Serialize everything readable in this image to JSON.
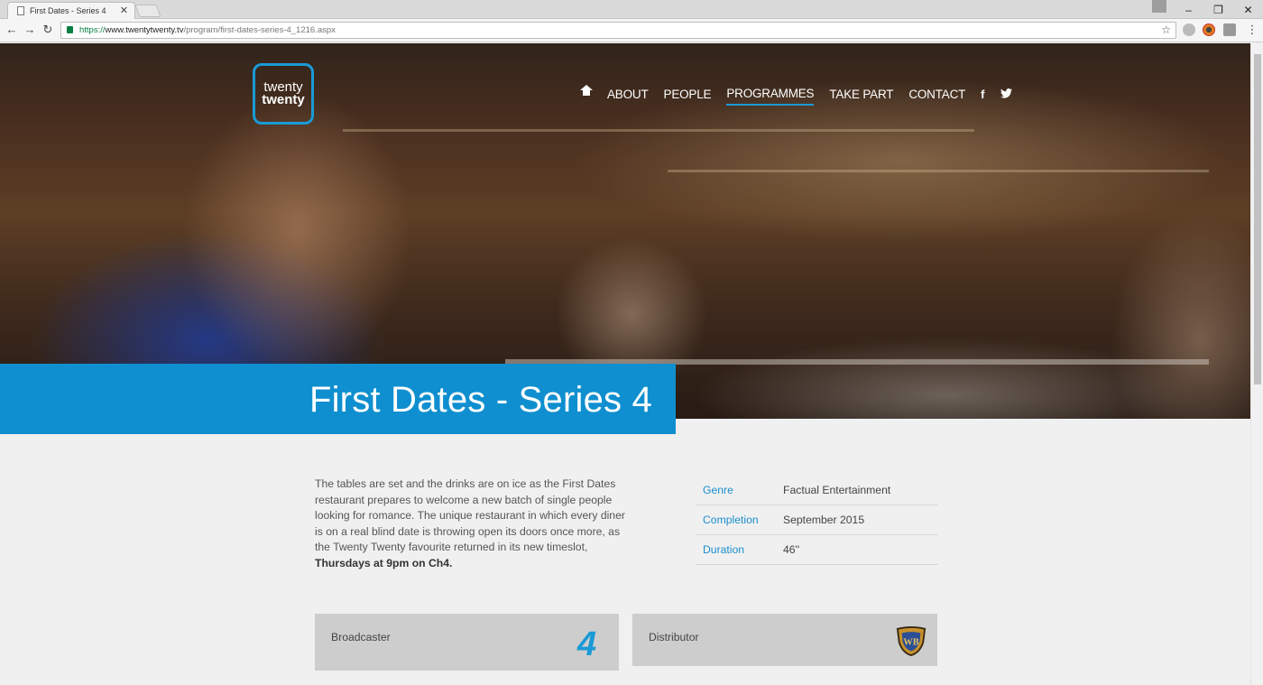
{
  "browser": {
    "tab_title": "First Dates - Series 4",
    "url_scheme": "https://",
    "url_host": "www.twentytwenty.tv",
    "url_path": "/program/first-dates-series-4_1216.aspx"
  },
  "site": {
    "logo_line1": "twenty",
    "logo_line2": "twenty",
    "nav": [
      {
        "label": "ABOUT",
        "active": false
      },
      {
        "label": "PEOPLE",
        "active": false
      },
      {
        "label": "PROGRAMMES",
        "active": true
      },
      {
        "label": "TAKE PART",
        "active": false
      },
      {
        "label": "CONTACT",
        "active": false
      }
    ],
    "social": [
      "facebook-icon",
      "twitter-icon"
    ],
    "accent_color": "#0f8fcf"
  },
  "programme": {
    "title": "First Dates - Series 4",
    "synopsis": "The tables are set and the drinks are on ice as the First Dates restaurant prepares to welcome a new batch of single people looking for romance. The unique restaurant in which every diner is on a real blind date is throwing open its doors once more, as the Twenty Twenty favourite returned in its new timeslot, ",
    "synopsis_bold": "Thursdays at 9pm on Ch4.",
    "details": [
      {
        "key": "Genre",
        "value": "Factual Entertainment"
      },
      {
        "key": "Completion",
        "value": "September 2015"
      },
      {
        "key": "Duration",
        "value": "46''"
      }
    ],
    "broadcaster_label": "Broadcaster",
    "broadcaster_logo": "channel-4-logo",
    "distributor_label": "Distributor",
    "distributor_logo": "warner-bros-logo"
  }
}
